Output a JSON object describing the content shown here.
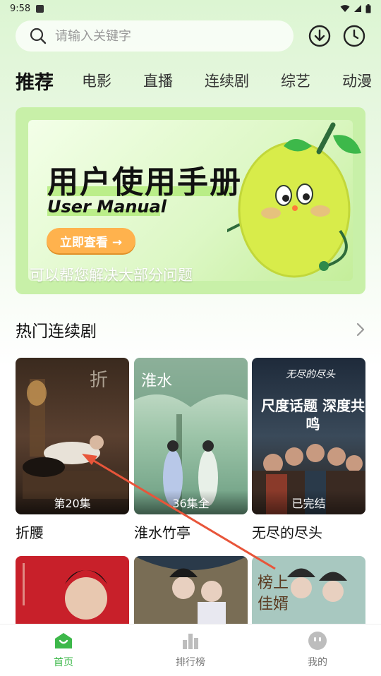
{
  "status_bar": {
    "time": "9:58"
  },
  "search": {
    "placeholder": "请输入关键字"
  },
  "tabs": [
    {
      "label": "推荐",
      "active": true
    },
    {
      "label": "电影"
    },
    {
      "label": "直播"
    },
    {
      "label": "连续剧"
    },
    {
      "label": "综艺"
    },
    {
      "label": "动漫"
    }
  ],
  "banner": {
    "title": "用户使用手册",
    "subtitle": "User Manual",
    "button": "立即查看 →",
    "caption": "可以帮您解决大部分问题",
    "accent": "#a8e86a",
    "button_color": "#ffb24d"
  },
  "section": {
    "title": "热门连续剧"
  },
  "dramas": [
    {
      "title": "折腰",
      "badge": "第20集"
    },
    {
      "title": "淮水竹亭",
      "badge": "36集全"
    },
    {
      "title": "无尽的尽头",
      "badge": "已完结",
      "poster_text": "尺度话题 深度共鸣"
    }
  ],
  "nav": [
    {
      "label": "首页",
      "icon": "home-icon",
      "active": true
    },
    {
      "label": "排行榜",
      "icon": "ranking-icon"
    },
    {
      "label": "我的",
      "icon": "profile-icon"
    }
  ],
  "colors": {
    "brand_green": "#3db84a",
    "annotation_arrow": "#e8553a"
  }
}
